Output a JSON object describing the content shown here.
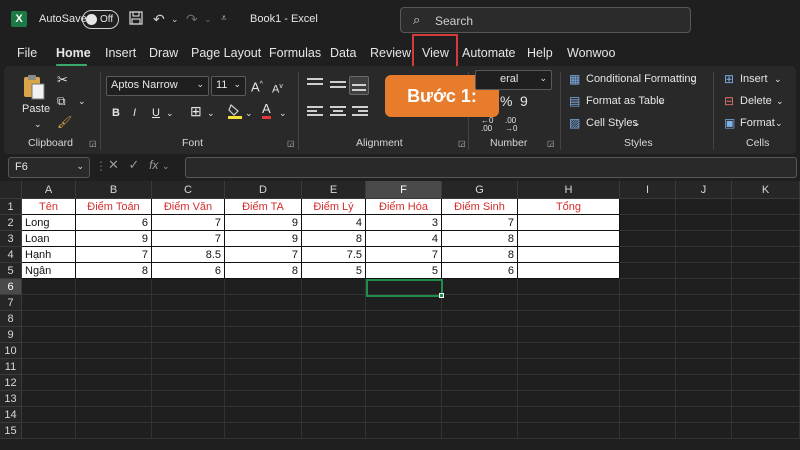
{
  "titlebar": {
    "autosave_label": "AutoSave",
    "toggle_state": "Off",
    "doc_name": "Book1 - Excel",
    "search_placeholder": "Search"
  },
  "tabs": [
    "File",
    "Home",
    "Insert",
    "Draw",
    "Page Layout",
    "Formulas",
    "Data",
    "Review",
    "View",
    "Automate",
    "Help",
    "Wonwoo"
  ],
  "active_tab": "Home",
  "highlighted_tab": "View",
  "ribbon": {
    "clipboard": {
      "paste": "Paste",
      "label": "Clipboard"
    },
    "font": {
      "name": "Aptos Narrow",
      "size": "11",
      "label": "Font",
      "bold": "B",
      "italic": "I",
      "underline": "U",
      "grow": "A",
      "shrink": "A",
      "font_color": "A"
    },
    "alignment": {
      "label": "Alignment"
    },
    "number": {
      "format": "eral",
      "label": "Number"
    },
    "styles": {
      "conditional": "Conditional Formatting",
      "format_table": "Format as Table",
      "cell_styles": "Cell Styles",
      "label": "Styles"
    },
    "cells": {
      "insert": "Insert",
      "delete": "Delete",
      "format": "Format",
      "label": "Cells"
    }
  },
  "callout": "Bước 1:",
  "formula_bar": {
    "name_box": "F6",
    "fx": "fx",
    "value": ""
  },
  "columns": [
    "A",
    "B",
    "C",
    "D",
    "E",
    "F",
    "G",
    "H",
    "I",
    "J",
    "K"
  ],
  "selected_column": "F",
  "rows": [
    "1",
    "2",
    "3",
    "4",
    "5",
    "6",
    "7",
    "8",
    "9",
    "10",
    "11",
    "12",
    "13",
    "14",
    "15"
  ],
  "selected_row": "6",
  "table": {
    "headers": [
      "Tên",
      "Điểm Toán",
      "Điểm Văn",
      "Điểm TA",
      "Điểm Lý",
      "Điểm Hóa",
      "Điểm Sinh",
      "Tổng"
    ],
    "rows": [
      [
        "Long",
        "6",
        "7",
        "9",
        "4",
        "3",
        "7",
        ""
      ],
      [
        "Loan",
        "9",
        "7",
        "9",
        "8",
        "4",
        "8",
        ""
      ],
      [
        "Hạnh",
        "7",
        "8.5",
        "7",
        "7.5",
        "7",
        "8",
        ""
      ],
      [
        "Ngân",
        "8",
        "6",
        "8",
        "5",
        "5",
        "6",
        ""
      ]
    ]
  },
  "colors": {
    "accent_green": "#1e8f4a",
    "callout": "#e87c2d",
    "highlight": "#d43b3b",
    "header_red": "#d42d2d"
  }
}
